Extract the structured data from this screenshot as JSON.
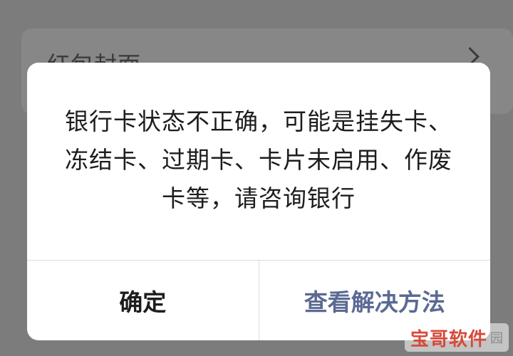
{
  "background": {
    "row_label": "红包封面"
  },
  "dialog": {
    "message_lines": [
      "银行卡状态不正确，可能是挂失卡、",
      "冻结卡、过期卡、卡片未启用、作废",
      "卡等，请咨询银行"
    ],
    "confirm_label": "确定",
    "solution_label": "查看解决方法"
  },
  "watermark": {
    "text": "宝哥软件",
    "suffix": "园"
  },
  "colors": {
    "overlay": "#7c7c7c",
    "dialog_bg": "#ffffff",
    "text": "#1d1d1d",
    "link": "#5b6a93",
    "watermark": "#d64a3a"
  }
}
